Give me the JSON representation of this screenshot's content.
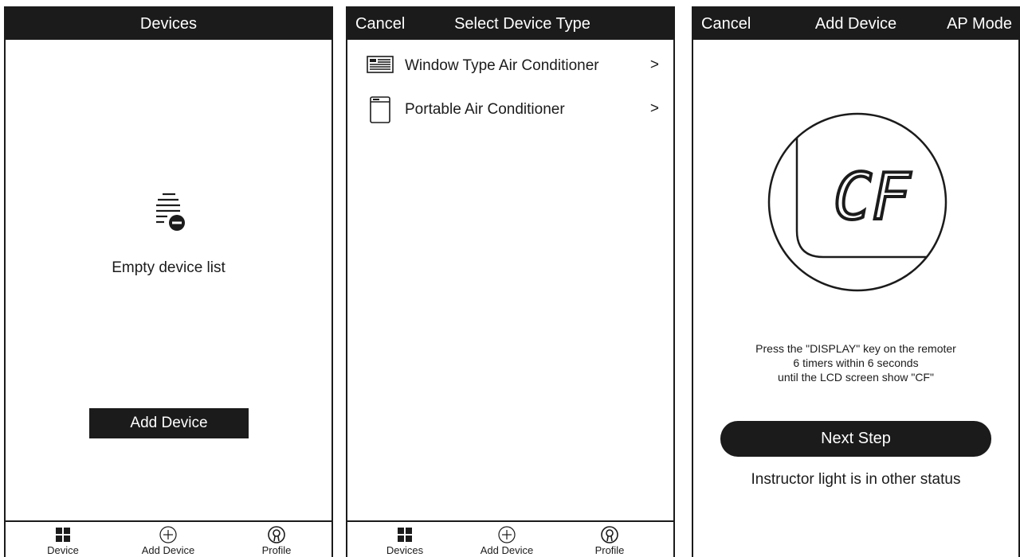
{
  "screen1": {
    "title": "Devices",
    "empty_text": "Empty device list",
    "add_button": "Add Device",
    "empty_icon": "empty-list-icon",
    "tabs": [
      {
        "label": "Device",
        "icon": "grid-icon"
      },
      {
        "label": "Add Device",
        "icon": "plus-circle-icon"
      },
      {
        "label": "Profile",
        "icon": "profile-icon"
      }
    ]
  },
  "screen2": {
    "cancel": "Cancel",
    "title": "Select Device Type",
    "device_types": [
      {
        "label": "Window Type Air Conditioner",
        "icon": "window-ac-icon",
        "chevron": ">"
      },
      {
        "label": "Portable Air Conditioner",
        "icon": "portable-ac-icon",
        "chevron": ">"
      }
    ],
    "tabs": [
      {
        "label": "Devices",
        "icon": "grid-icon"
      },
      {
        "label": "Add Device",
        "icon": "plus-circle-icon"
      },
      {
        "label": "Profile",
        "icon": "profile-icon"
      }
    ]
  },
  "screen3": {
    "cancel": "Cancel",
    "title": "Add Device",
    "mode": "AP Mode",
    "display_code": "CF",
    "instructions": [
      "Press the \"DISPLAY\" key on the remoter",
      "6 timers within 6 seconds",
      "until the LCD screen show \"CF\""
    ],
    "next_button": "Next Step",
    "status_link": "Instructor light is in other status"
  },
  "colors": {
    "primary": "#1b1b1b",
    "background": "#ffffff"
  }
}
